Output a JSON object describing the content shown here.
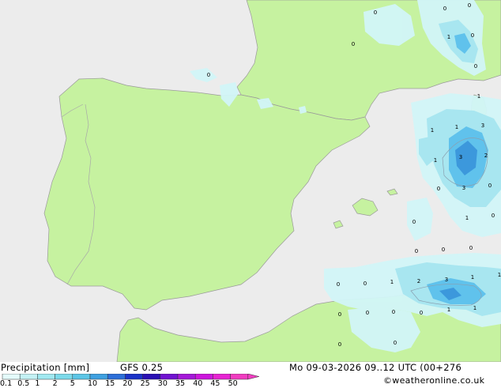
{
  "footer": {
    "title": "Precipitation [mm]",
    "model": "GFS 0.25",
    "datetime": "Mo 09-03-2026 09..12 UTC (00+276",
    "credit": "©weatheronline.co.uk"
  },
  "legend": {
    "ticks": [
      "0.1",
      "0.5",
      "1",
      "2",
      "5",
      "10",
      "15",
      "20",
      "25",
      "30",
      "35",
      "40",
      "45",
      "50"
    ],
    "colors": [
      "#e4fbfb",
      "#c4f1f4",
      "#a0e8f0",
      "#7cdaea",
      "#5cc6e6",
      "#3ea0e0",
      "#2c6ed8",
      "#1b33c8",
      "#2a10b4",
      "#7012d0",
      "#a418d8",
      "#cc16dc",
      "#e624d2",
      "#f03cc0"
    ]
  },
  "colors": {
    "sea": "#ececec",
    "land": "#c6f2a0",
    "precip_light": "#d2f6f8",
    "precip_mid": "#a8e6f0",
    "precip_heavy": "#60c2ec",
    "precip_max": "#3c98dc"
  },
  "map_values": [
    "0",
    "0",
    "0",
    "1",
    "0",
    "0",
    "0",
    "0",
    "1",
    "1",
    "3",
    "1",
    "3",
    "2",
    "1",
    "3",
    "0",
    "0",
    "0",
    "1",
    "0",
    "0",
    "0",
    "0",
    "0",
    "1",
    "2",
    "3",
    "1",
    "1",
    "0",
    "0",
    "0",
    "0",
    "1",
    "1",
    "0",
    "0",
    "0"
  ]
}
